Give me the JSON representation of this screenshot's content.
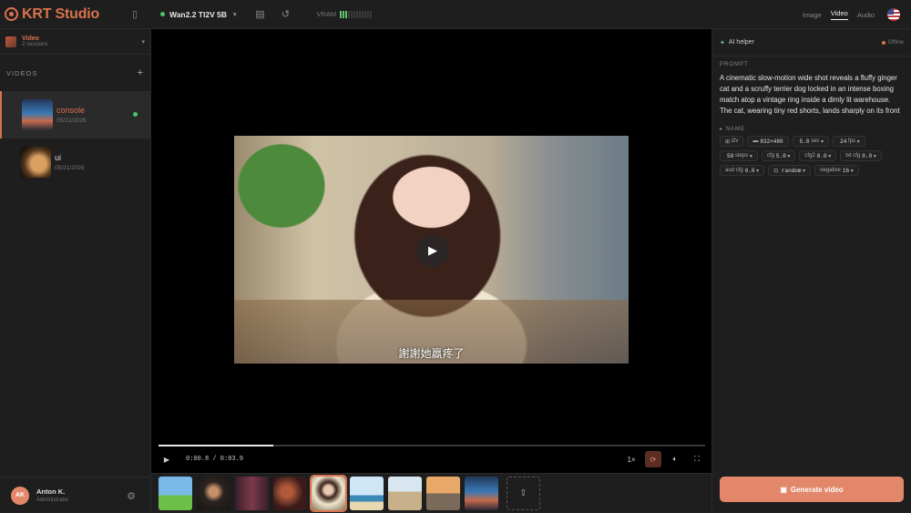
{
  "app": {
    "title": "KRT Studio"
  },
  "topbar": {
    "model": "Wan2.2 TI2V 5B",
    "vram_label": "VRAM",
    "vram_level": 0.25,
    "mode_tabs": [
      "Image",
      "Video",
      "Audio"
    ],
    "active_mode": "Video"
  },
  "sidebar": {
    "project": {
      "name": "Video",
      "subtitle": "2 sessions"
    },
    "section_title": "VIDEOS",
    "videos": [
      {
        "title": "console",
        "date": "05/22/2026",
        "active": true
      },
      {
        "title": "ui",
        "date": "05/21/2026",
        "active": false
      }
    ],
    "user": {
      "initials": "AK",
      "name": "Anton K.",
      "role": "Administrator"
    }
  },
  "player": {
    "subtitle": "謝謝她贏疼了",
    "time": "0:00.8 / 0:03.9",
    "progress": 0.21,
    "speed": "1×",
    "filmstrip_count": 9,
    "active_clip": 5
  },
  "rpanel": {
    "header": "AI helper",
    "status": "Offline",
    "prompt_label": "PROMPT",
    "prompt": "A cinematic slow-motion wide shot reveals a fluffy ginger cat and a scruffy terrier dog locked in an intense boxing match atop a vintage ring inside a dimly lit warehouse. The cat, wearing tiny red shorts, lands sharply on its front",
    "name_label": "NAME",
    "chips": {
      "mode": "i2v",
      "resolution": "832×480",
      "duration": "5.0",
      "duration_unit": "sec",
      "fps": "24",
      "fps_unit": "fps",
      "steps": "50",
      "steps_unit": "steps",
      "cfg_label": "cfg",
      "cfg": "5.0",
      "cfg2_label": "cfg2",
      "cfg2": "0.0",
      "txtcfg_label": "txt cfg",
      "txtcfg": "0.0",
      "audcfg_label": "aud cfg",
      "audcfg": "0.0",
      "seed": "random",
      "negative_label": "negative",
      "negative": "16"
    },
    "generate_label": "Generate video"
  },
  "colors": {
    "accent": "#d9724e",
    "online": "#4cc46a"
  }
}
